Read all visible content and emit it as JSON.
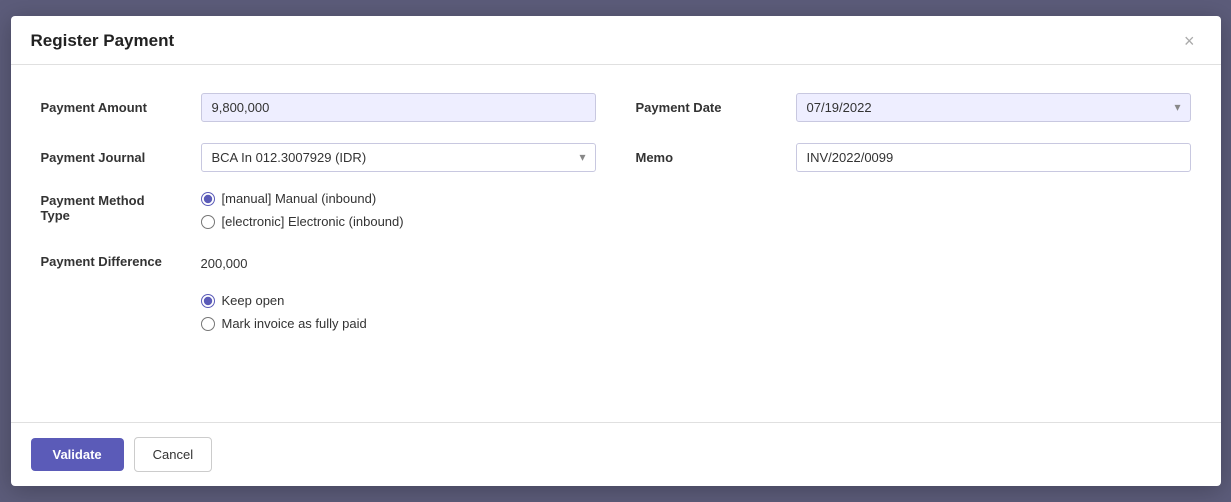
{
  "dialog": {
    "title": "Register Payment",
    "close_icon": "×"
  },
  "form": {
    "left": {
      "payment_amount_label": "Payment Amount",
      "payment_amount_value": "9,800,000",
      "payment_journal_label": "Payment Journal",
      "payment_journal_value": "BCA In 012.3007929 (IDR)",
      "payment_journal_options": [
        "BCA In 012.3007929 (IDR)"
      ],
      "payment_method_label": "Payment Method\nType",
      "payment_method_label_line1": "Payment Method",
      "payment_method_label_line2": "Type",
      "method_manual_label": "[manual] Manual (inbound)",
      "method_electronic_label": "[electronic] Electronic (inbound)",
      "payment_difference_label": "Payment Difference",
      "payment_difference_value": "200,000",
      "keep_open_label": "Keep open",
      "mark_paid_label": "Mark invoice as fully paid"
    },
    "right": {
      "payment_date_label": "Payment Date",
      "payment_date_value": "07/19/2022",
      "memo_label": "Memo",
      "memo_value": "INV/2022/0099"
    }
  },
  "footer": {
    "validate_label": "Validate",
    "cancel_label": "Cancel"
  }
}
